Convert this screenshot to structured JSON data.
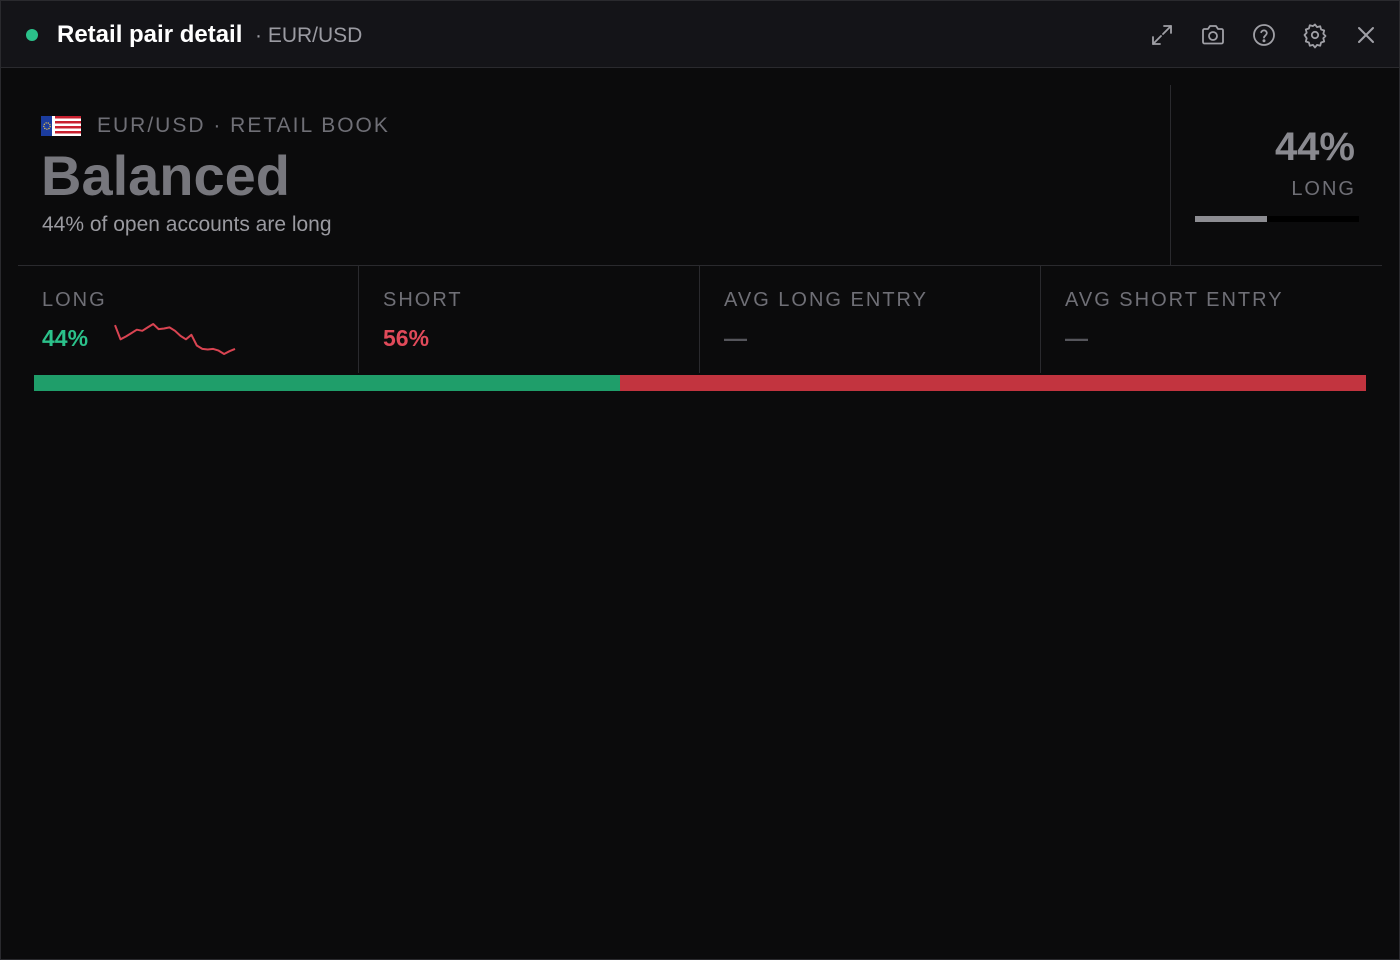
{
  "window": {
    "title": "Retail pair detail",
    "subtitle": "· EUR/USD",
    "status_color": "#2bc18a",
    "toolbar_icons": [
      "expand-icon",
      "camera-icon",
      "help-icon",
      "gear-icon",
      "close-icon"
    ]
  },
  "header": {
    "pair_label": "EUR/USD · RETAIL BOOK",
    "sentiment": "Balanced",
    "description": "44% of open accounts are long",
    "big_percent": "44%",
    "big_label": "LONG",
    "long_fraction": 0.44
  },
  "stats": [
    {
      "label": "LONG",
      "value": "44%",
      "color": "#2bc18a"
    },
    {
      "label": "SHORT",
      "value": "56%",
      "color": "#e04a5a"
    },
    {
      "label": "AVG LONG ENTRY",
      "value": "—",
      "color": "#55555b"
    },
    {
      "label": "AVG SHORT ENTRY",
      "value": "—",
      "color": "#55555b"
    }
  ],
  "sparkline": {
    "color": "#d94452",
    "values": [
      46,
      43.5,
      44,
      44.6,
      45.2,
      45,
      45.6,
      46.2,
      45.3,
      45.4,
      45.6,
      45,
      44.1,
      43.5,
      44.3,
      42.4,
      41.8,
      41.7,
      41.8,
      41.5,
      40.9,
      41.4,
      41.8
    ]
  },
  "ratio_bar": {
    "long_fraction": 0.44,
    "long_color": "#1f9e6a",
    "short_color": "#c2343f"
  }
}
